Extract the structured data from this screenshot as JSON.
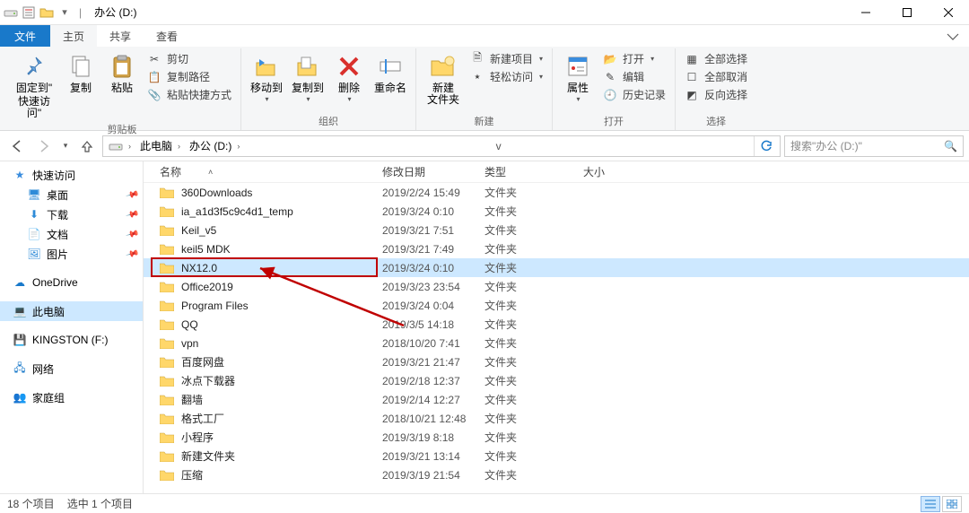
{
  "window": {
    "title": "办公 (D:)",
    "sep": "|"
  },
  "ribbon_tabs": {
    "file": "文件",
    "home": "主页",
    "share": "共享",
    "view": "查看"
  },
  "ribbon": {
    "pin": {
      "line1": "固定到\"",
      "line2": "快速访问\""
    },
    "copy": "复制",
    "paste": "粘贴",
    "cut": "剪切",
    "copy_path": "复制路径",
    "paste_shortcut": "粘贴快捷方式",
    "clipboard_group": "剪贴板",
    "move_to": "移动到",
    "copy_to": "复制到",
    "delete": "删除",
    "rename": "重命名",
    "organize_group": "组织",
    "new_folder": "新建\n文件夹",
    "new_item": "新建项目",
    "easy_access": "轻松访问",
    "new_group": "新建",
    "properties": "属性",
    "open": "打开",
    "edit": "编辑",
    "history": "历史记录",
    "open_group": "打开",
    "select_all": "全部选择",
    "select_none": "全部取消",
    "invert_selection": "反向选择",
    "select_group": "选择"
  },
  "breadcrumbs": {
    "this_pc": "此电脑",
    "drive": "办公 (D:)"
  },
  "search": {
    "placeholder": "搜索\"办公 (D:)\""
  },
  "tree": {
    "quick_access": "快速访问",
    "desktop": "桌面",
    "downloads": "下载",
    "documents": "文档",
    "pictures": "图片",
    "onedrive": "OneDrive",
    "this_pc": "此电脑",
    "kingston": "KINGSTON (F:)",
    "network": "网络",
    "homegroup": "家庭组"
  },
  "columns": {
    "name": "名称",
    "date_modified": "修改日期",
    "type": "类型",
    "size": "大小"
  },
  "type_folder": "文件夹",
  "rows": [
    {
      "name": "360Downloads",
      "date": "2019/2/24 15:49"
    },
    {
      "name": "ia_a1d3f5c9c4d1_temp",
      "date": "2019/3/24 0:10"
    },
    {
      "name": "Keil_v5",
      "date": "2019/3/21 7:51"
    },
    {
      "name": "keil5 MDK",
      "date": "2019/3/21 7:49"
    },
    {
      "name": "NX12.0",
      "date": "2019/3/24 0:10",
      "selected": true
    },
    {
      "name": "Office2019",
      "date": "2019/3/23 23:54"
    },
    {
      "name": "Program Files",
      "date": "2019/3/24 0:04"
    },
    {
      "name": "QQ",
      "date": "2019/3/5 14:18"
    },
    {
      "name": "vpn",
      "date": "2018/10/20 7:41"
    },
    {
      "name": "百度网盘",
      "date": "2019/3/21 21:47"
    },
    {
      "name": "冰点下载器",
      "date": "2019/2/18 12:37"
    },
    {
      "name": "翻墙",
      "date": "2019/2/14 12:27"
    },
    {
      "name": "格式工厂",
      "date": "2018/10/21 12:48"
    },
    {
      "name": "小程序",
      "date": "2019/3/19 8:18"
    },
    {
      "name": "新建文件夹",
      "date": "2019/3/21 13:14"
    },
    {
      "name": "压缩",
      "date": "2019/3/19 21:54"
    }
  ],
  "status": {
    "count": "18 个项目",
    "selected": "选中 1 个项目"
  }
}
